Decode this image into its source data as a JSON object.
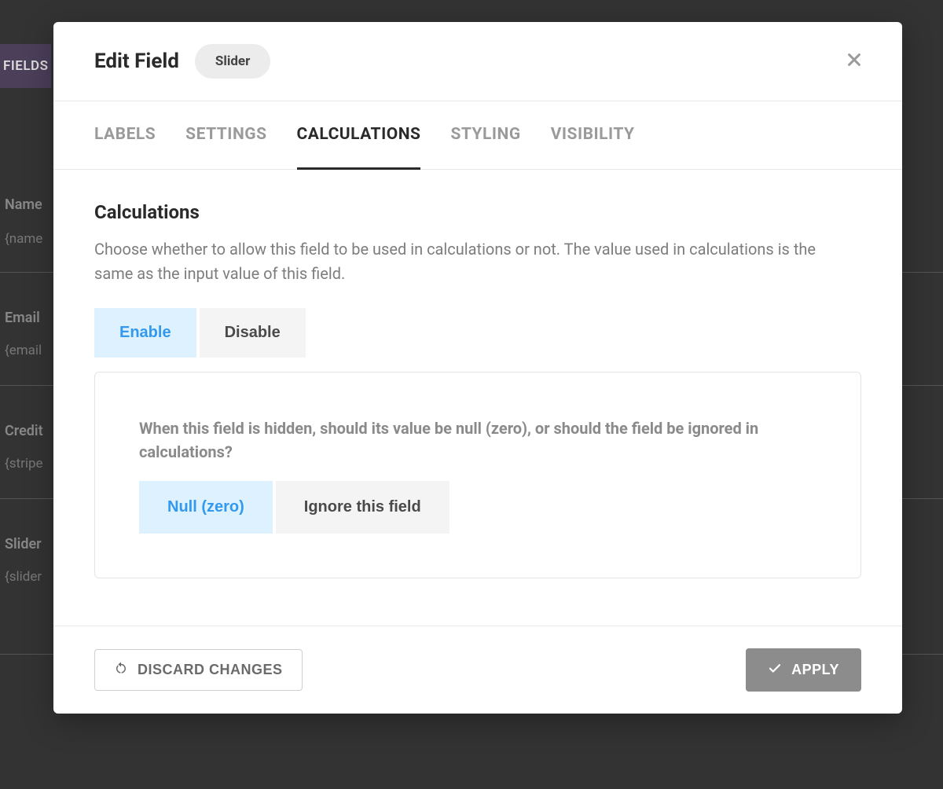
{
  "backdrop": {
    "tab": "FIELDS",
    "items": [
      {
        "label": "Name",
        "token": "{name"
      },
      {
        "label": "Email",
        "token": "{email"
      },
      {
        "label": "Credit",
        "token": "{stripe"
      },
      {
        "label": "Slider",
        "token": "{slider"
      }
    ]
  },
  "modal": {
    "title": "Edit Field",
    "field_type": "Slider",
    "tabs": [
      {
        "label": "LABELS",
        "active": false
      },
      {
        "label": "SETTINGS",
        "active": false
      },
      {
        "label": "CALCULATIONS",
        "active": true
      },
      {
        "label": "STYLING",
        "active": false
      },
      {
        "label": "VISIBILITY",
        "active": false
      }
    ],
    "section": {
      "title": "Calculations",
      "description": "Choose whether to allow this field to be used in calculations or not. The value used in calculations is the same as the input value of this field.",
      "toggle": {
        "enable": "Enable",
        "disable": "Disable",
        "selected": "enable"
      },
      "hidden_panel": {
        "question": "When this field is hidden, should its value be null (zero), or should the field be ignored in calculations?",
        "null_zero": "Null (zero)",
        "ignore": "Ignore this field",
        "selected": "null_zero"
      }
    },
    "footer": {
      "discard": "DISCARD CHANGES",
      "apply": "APPLY"
    }
  }
}
